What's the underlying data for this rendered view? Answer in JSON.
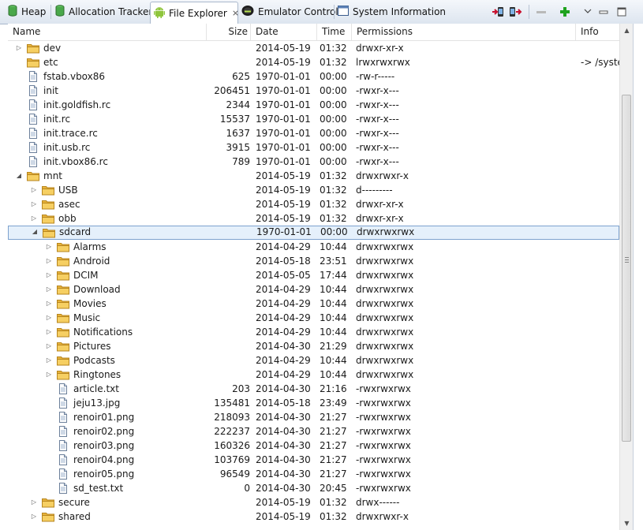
{
  "tabs": [
    {
      "label": "Heap",
      "icon": "cylinder-icon"
    },
    {
      "label": "Allocation Tracker",
      "icon": "cylinder-icon"
    },
    {
      "label": "File Explorer",
      "icon": "android-icon",
      "active": true
    },
    {
      "label": "Emulator Control",
      "icon": "phone-icon"
    },
    {
      "label": "System Information",
      "icon": "window-icon"
    }
  ],
  "toolbar": [
    "pull-file-icon",
    "push-file-icon",
    "delete-icon",
    "new-folder-icon",
    "view-menu-icon",
    "minimize-icon",
    "maximize-icon"
  ],
  "columns": {
    "name": "Name",
    "size": "Size",
    "date": "Date",
    "time": "Time",
    "permissions": "Permissions",
    "info": "Info"
  },
  "colors": {
    "folder": "#f3c34f",
    "selection": "#e5f0fb",
    "plus": "#1fa31f"
  },
  "rows": [
    {
      "name": "dev",
      "type": "folder",
      "depth": 0,
      "expander": "collapsed",
      "size": "",
      "date": "2014-05-19",
      "time": "01:32",
      "perm": "drwxr-xr-x",
      "info": ""
    },
    {
      "name": "etc",
      "type": "folder",
      "depth": 0,
      "expander": "none",
      "size": "",
      "date": "2014-05-19",
      "time": "01:32",
      "perm": "lrwxrwxrwx",
      "info": "-> /system/etc"
    },
    {
      "name": "fstab.vbox86",
      "type": "file",
      "depth": 0,
      "expander": "none",
      "size": "625",
      "date": "1970-01-01",
      "time": "00:00",
      "perm": "-rw-r-----",
      "info": ""
    },
    {
      "name": "init",
      "type": "file",
      "depth": 0,
      "expander": "none",
      "size": "206451",
      "date": "1970-01-01",
      "time": "00:00",
      "perm": "-rwxr-x---",
      "info": ""
    },
    {
      "name": "init.goldfish.rc",
      "type": "file",
      "depth": 0,
      "expander": "none",
      "size": "2344",
      "date": "1970-01-01",
      "time": "00:00",
      "perm": "-rwxr-x---",
      "info": ""
    },
    {
      "name": "init.rc",
      "type": "file",
      "depth": 0,
      "expander": "none",
      "size": "15537",
      "date": "1970-01-01",
      "time": "00:00",
      "perm": "-rwxr-x---",
      "info": ""
    },
    {
      "name": "init.trace.rc",
      "type": "file",
      "depth": 0,
      "expander": "none",
      "size": "1637",
      "date": "1970-01-01",
      "time": "00:00",
      "perm": "-rwxr-x---",
      "info": ""
    },
    {
      "name": "init.usb.rc",
      "type": "file",
      "depth": 0,
      "expander": "none",
      "size": "3915",
      "date": "1970-01-01",
      "time": "00:00",
      "perm": "-rwxr-x---",
      "info": ""
    },
    {
      "name": "init.vbox86.rc",
      "type": "file",
      "depth": 0,
      "expander": "none",
      "size": "789",
      "date": "1970-01-01",
      "time": "00:00",
      "perm": "-rwxr-x---",
      "info": ""
    },
    {
      "name": "mnt",
      "type": "folder",
      "depth": 0,
      "expander": "expanded",
      "size": "",
      "date": "2014-05-19",
      "time": "01:32",
      "perm": "drwxrwxr-x",
      "info": ""
    },
    {
      "name": "USB",
      "type": "folder",
      "depth": 1,
      "expander": "collapsed",
      "size": "",
      "date": "2014-05-19",
      "time": "01:32",
      "perm": "d---------",
      "info": ""
    },
    {
      "name": "asec",
      "type": "folder",
      "depth": 1,
      "expander": "collapsed",
      "size": "",
      "date": "2014-05-19",
      "time": "01:32",
      "perm": "drwxr-xr-x",
      "info": ""
    },
    {
      "name": "obb",
      "type": "folder",
      "depth": 1,
      "expander": "collapsed",
      "size": "",
      "date": "2014-05-19",
      "time": "01:32",
      "perm": "drwxr-xr-x",
      "info": ""
    },
    {
      "name": "sdcard",
      "type": "folder",
      "depth": 1,
      "expander": "expanded",
      "size": "",
      "date": "1970-01-01",
      "time": "00:00",
      "perm": "drwxrwxrwx",
      "info": "",
      "selected": true
    },
    {
      "name": "Alarms",
      "type": "folder",
      "depth": 2,
      "expander": "collapsed",
      "size": "",
      "date": "2014-04-29",
      "time": "10:44",
      "perm": "drwxrwxrwx",
      "info": ""
    },
    {
      "name": "Android",
      "type": "folder",
      "depth": 2,
      "expander": "collapsed",
      "size": "",
      "date": "2014-05-18",
      "time": "23:51",
      "perm": "drwxrwxrwx",
      "info": ""
    },
    {
      "name": "DCIM",
      "type": "folder",
      "depth": 2,
      "expander": "collapsed",
      "size": "",
      "date": "2014-05-05",
      "time": "17:44",
      "perm": "drwxrwxrwx",
      "info": ""
    },
    {
      "name": "Download",
      "type": "folder",
      "depth": 2,
      "expander": "collapsed",
      "size": "",
      "date": "2014-04-29",
      "time": "10:44",
      "perm": "drwxrwxrwx",
      "info": ""
    },
    {
      "name": "Movies",
      "type": "folder",
      "depth": 2,
      "expander": "collapsed",
      "size": "",
      "date": "2014-04-29",
      "time": "10:44",
      "perm": "drwxrwxrwx",
      "info": ""
    },
    {
      "name": "Music",
      "type": "folder",
      "depth": 2,
      "expander": "collapsed",
      "size": "",
      "date": "2014-04-29",
      "time": "10:44",
      "perm": "drwxrwxrwx",
      "info": ""
    },
    {
      "name": "Notifications",
      "type": "folder",
      "depth": 2,
      "expander": "collapsed",
      "size": "",
      "date": "2014-04-29",
      "time": "10:44",
      "perm": "drwxrwxrwx",
      "info": ""
    },
    {
      "name": "Pictures",
      "type": "folder",
      "depth": 2,
      "expander": "collapsed",
      "size": "",
      "date": "2014-04-30",
      "time": "21:29",
      "perm": "drwxrwxrwx",
      "info": ""
    },
    {
      "name": "Podcasts",
      "type": "folder",
      "depth": 2,
      "expander": "collapsed",
      "size": "",
      "date": "2014-04-29",
      "time": "10:44",
      "perm": "drwxrwxrwx",
      "info": ""
    },
    {
      "name": "Ringtones",
      "type": "folder",
      "depth": 2,
      "expander": "collapsed",
      "size": "",
      "date": "2014-04-29",
      "time": "10:44",
      "perm": "drwxrwxrwx",
      "info": ""
    },
    {
      "name": "article.txt",
      "type": "file",
      "depth": 2,
      "expander": "none",
      "size": "203",
      "date": "2014-04-30",
      "time": "21:16",
      "perm": "-rwxrwxrwx",
      "info": ""
    },
    {
      "name": "jeju13.jpg",
      "type": "file",
      "depth": 2,
      "expander": "none",
      "size": "135481",
      "date": "2014-05-18",
      "time": "23:49",
      "perm": "-rwxrwxrwx",
      "info": ""
    },
    {
      "name": "renoir01.png",
      "type": "file",
      "depth": 2,
      "expander": "none",
      "size": "218093",
      "date": "2014-04-30",
      "time": "21:27",
      "perm": "-rwxrwxrwx",
      "info": ""
    },
    {
      "name": "renoir02.png",
      "type": "file",
      "depth": 2,
      "expander": "none",
      "size": "222237",
      "date": "2014-04-30",
      "time": "21:27",
      "perm": "-rwxrwxrwx",
      "info": ""
    },
    {
      "name": "renoir03.png",
      "type": "file",
      "depth": 2,
      "expander": "none",
      "size": "160326",
      "date": "2014-04-30",
      "time": "21:27",
      "perm": "-rwxrwxrwx",
      "info": ""
    },
    {
      "name": "renoir04.png",
      "type": "file",
      "depth": 2,
      "expander": "none",
      "size": "103769",
      "date": "2014-04-30",
      "time": "21:27",
      "perm": "-rwxrwxrwx",
      "info": ""
    },
    {
      "name": "renoir05.png",
      "type": "file",
      "depth": 2,
      "expander": "none",
      "size": "96549",
      "date": "2014-04-30",
      "time": "21:27",
      "perm": "-rwxrwxrwx",
      "info": ""
    },
    {
      "name": "sd_test.txt",
      "type": "file",
      "depth": 2,
      "expander": "none",
      "size": "0",
      "date": "2014-04-30",
      "time": "20:45",
      "perm": "-rwxrwxrwx",
      "info": ""
    },
    {
      "name": "secure",
      "type": "folder",
      "depth": 1,
      "expander": "collapsed",
      "size": "",
      "date": "2014-05-19",
      "time": "01:32",
      "perm": "drwx------",
      "info": ""
    },
    {
      "name": "shared",
      "type": "folder",
      "depth": 1,
      "expander": "collapsed",
      "size": "",
      "date": "2014-05-19",
      "time": "01:32",
      "perm": "drwxrwxr-x",
      "info": ""
    }
  ]
}
